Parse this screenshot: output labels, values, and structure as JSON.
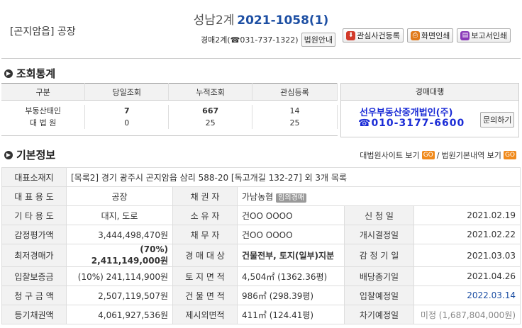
{
  "header": {
    "property_type": "[곤지암읍] 공장",
    "court": "성남2계",
    "case_number": "2021-1058(1)",
    "court_info": "경매2계(☎031-737-1322)",
    "court_guide_btn": "법원안내",
    "buttons": [
      "관심사건등록",
      "화면인쇄",
      "보고서인쇄"
    ]
  },
  "stats": {
    "title": "조회통계",
    "headers": [
      "구분",
      "당일조회",
      "누적조회",
      "관심등록"
    ],
    "rows": [
      [
        "부동산태인",
        "7",
        "667",
        "14"
      ],
      [
        "대 법 원",
        "0",
        "25",
        "25"
      ]
    ]
  },
  "agent": {
    "header": "경매대행",
    "name": "선우부동산중개법인(주)",
    "tel": "☎010-3177-6600",
    "inquiry_btn": "문의하기"
  },
  "basic": {
    "title": "기본정보",
    "link1": "대법원사이트 보기",
    "link2": "법원기본내역 보기",
    "go": "GO",
    "sep": "/",
    "address_label": "대표소재지",
    "address": "[목록2] 경기 광주시 곤지암읍 삼리 588-20 [독고개길 132-27] 외 3개 목록",
    "rows": [
      {
        "l1": "대 표 용 도",
        "v1": "공장",
        "l2": "채 권 자",
        "v2": "가남농협",
        "tag": "임의경매"
      },
      {
        "l1": "기 타 용 도",
        "v1": "대지, 도로",
        "l2": "소 유 자",
        "v2": "건OO OOOO",
        "l3": "신 청 일",
        "v3": "2021.02.19"
      },
      {
        "l1": "감정평가액",
        "v1": "3,444,498,470원",
        "l2": "채 무 자",
        "v2": "건OO OOOO",
        "l3": "개시결정일",
        "v3": "2021.02.22"
      },
      {
        "l1": "최저경매가",
        "v1": "(70%) 2,411,149,000원",
        "l2": "경 매 대 상",
        "v2": "건물전부, 토지(일부)지분",
        "l3": "감 정 기 일",
        "v3": "2021.03.03"
      },
      {
        "l1": "입찰보증금",
        "v1": "(10%) 241,114,900원",
        "l2": "토 지 면 적",
        "v2": "4,504㎡ (1362.36평)",
        "l3": "배당종기일",
        "v3": "2021.04.26"
      },
      {
        "l1": "청 구 금 액",
        "v1": "2,507,119,507원",
        "l2": "건 물 면 적",
        "v2": "986㎡ (298.39평)",
        "l3": "입찰예정일",
        "v3": "2022.03.14"
      },
      {
        "l1": "등기채권액",
        "v1": "4,061,927,536원",
        "l2": "제시외면적",
        "v2": "411㎡ (124.41평)",
        "l3": "차기예정일",
        "v3": "미정 (1,687,804,000원)"
      }
    ]
  }
}
